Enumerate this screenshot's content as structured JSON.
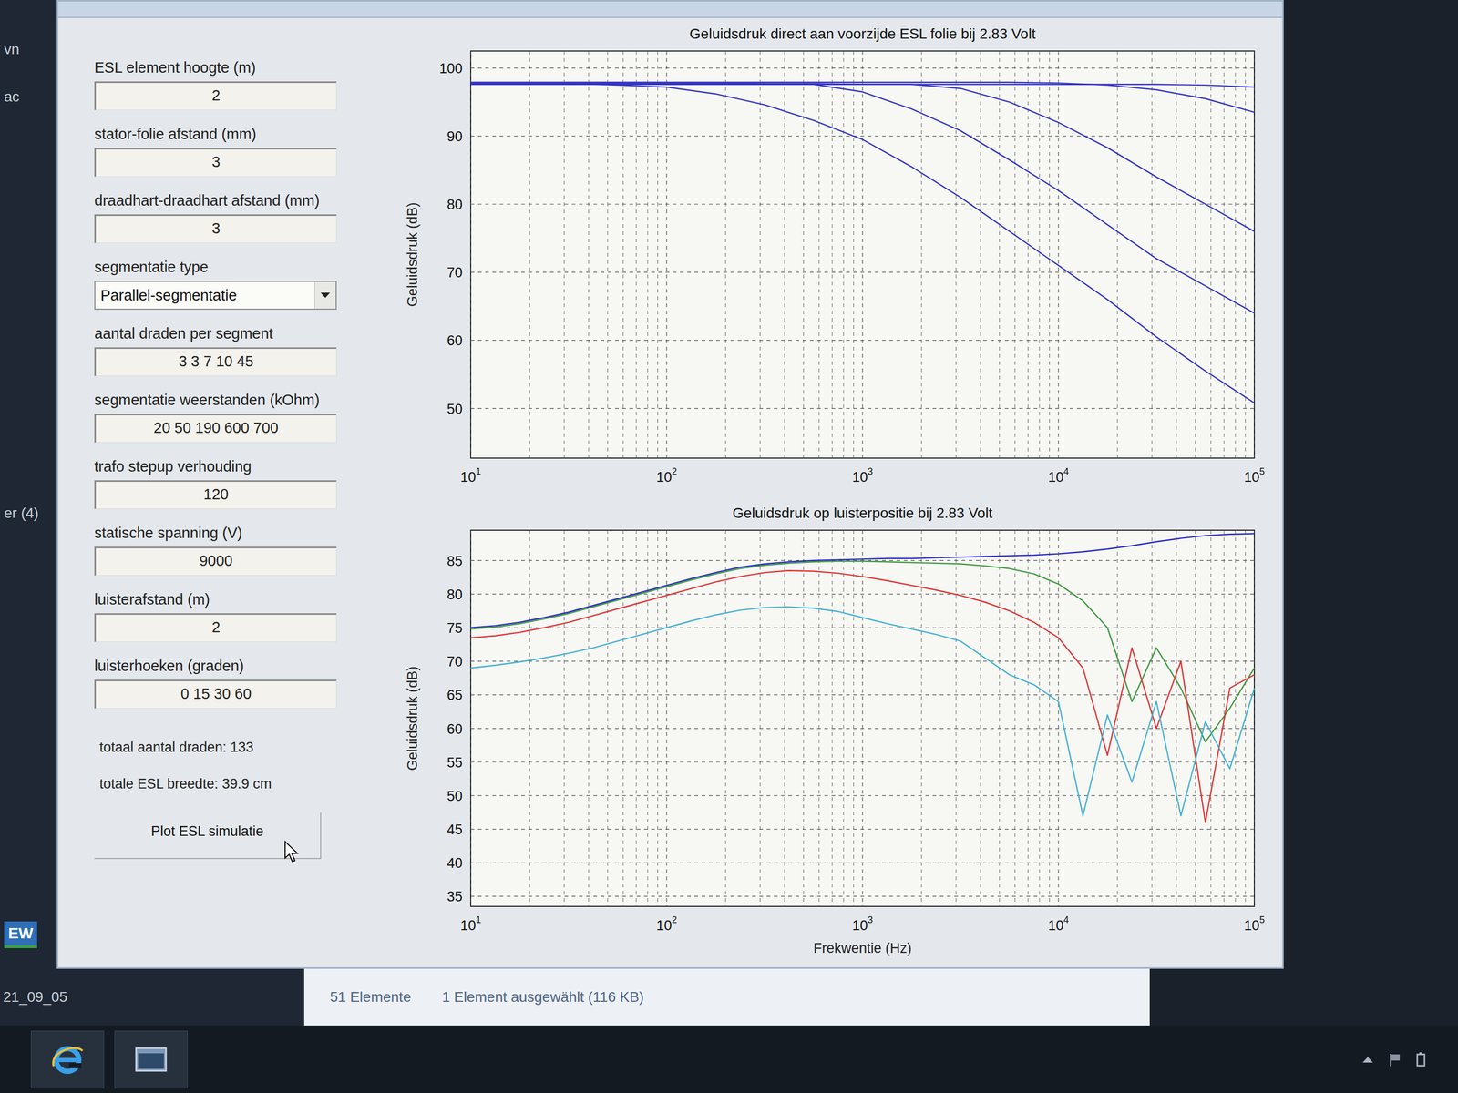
{
  "desktop_fragments": [
    "vn",
    "ac",
    "er (4)",
    "EW",
    "21_09_05"
  ],
  "form": {
    "fields": [
      {
        "label": "ESL element hoogte (m)",
        "value": "2",
        "kind": "input"
      },
      {
        "label": "stator-folie afstand (mm)",
        "value": "3",
        "kind": "input"
      },
      {
        "label": "draadhart-draadhart afstand (mm)",
        "value": "3",
        "kind": "input"
      },
      {
        "label": "segmentatie type",
        "value": "Parallel-segmentatie",
        "kind": "dropdown"
      },
      {
        "label": "aantal draden per segment",
        "value": "3 3 7 10 45",
        "kind": "input"
      },
      {
        "label": "segmentatie weerstanden (kOhm)",
        "value": "20 50 190 600 700",
        "kind": "input"
      },
      {
        "label": "trafo stepup verhouding",
        "value": "120",
        "kind": "input"
      },
      {
        "label": "statische spanning (V)",
        "value": "9000",
        "kind": "input"
      },
      {
        "label": "luisterafstand (m)",
        "value": "2",
        "kind": "input"
      },
      {
        "label": "luisterhoeken (graden)",
        "value": "0 15 30 60",
        "kind": "input"
      }
    ],
    "info": [
      "totaal aantal draden: 133",
      "totale ESL breedte: 39.9 cm"
    ],
    "button": "Plot ESL simulatie"
  },
  "charts": [
    {
      "title": "Geluidsdruk direct aan voorzijde ESL folie bij 2.83 Volt",
      "y_label": "Geluidsdruk (dB)",
      "y_ticks": [
        "100",
        "90",
        "80",
        "70",
        "60",
        "50"
      ],
      "x_ticks": [
        {
          "base": "10",
          "exp": "1"
        },
        {
          "base": "10",
          "exp": "2"
        },
        {
          "base": "10",
          "exp": "3"
        },
        {
          "base": "10",
          "exp": "4"
        },
        {
          "base": "10",
          "exp": "5"
        }
      ],
      "series": [
        {
          "values": [
            97.6,
            97.6,
            97.6,
            97.6,
            97.6,
            97.6,
            97.6,
            97.6,
            97.6,
            97.6,
            97.6,
            97.6,
            97.6,
            97.6,
            97.6,
            97.5,
            97.2
          ]
        },
        {
          "values": [
            97.9,
            97.9,
            97.9,
            97.9,
            97.9,
            97.9,
            97.9,
            97.9,
            97.9,
            97.9,
            97.9,
            97.9,
            97.8,
            97.5,
            96.8,
            95.5,
            93.5
          ]
        },
        {
          "values": [
            97.8,
            97.8,
            97.8,
            97.8,
            97.8,
            97.8,
            97.7,
            97.7,
            97.6,
            97.6,
            97,
            95,
            92,
            88.3,
            84,
            80,
            76
          ]
        },
        {
          "values": [
            97.7,
            97.7,
            97.7,
            97.7,
            97.7,
            97.7,
            97.6,
            97.6,
            96.5,
            94,
            90.8,
            86.5,
            82,
            77,
            72,
            68,
            64
          ]
        },
        {
          "values": [
            97.8,
            97.8,
            97.7,
            97.5,
            97.2,
            96.2,
            94.6,
            92.3,
            89.5,
            85.5,
            81,
            76,
            71,
            66,
            60.5,
            55.5,
            50.8
          ]
        }
      ]
    },
    {
      "title": "Geluidsdruk op luisterpositie bij 2.83 Volt",
      "y_label": "Geluidsdruk (dB)",
      "x_label": "Frekwentie (Hz)",
      "y_ticks": [
        "85",
        "80",
        "75",
        "70",
        "65",
        "60",
        "55",
        "50",
        "45",
        "40",
        "35"
      ],
      "x_ticks": [
        {
          "base": "10",
          "exp": "1"
        },
        {
          "base": "10",
          "exp": "2"
        },
        {
          "base": "10",
          "exp": "3"
        },
        {
          "base": "10",
          "exp": "4"
        },
        {
          "base": "10",
          "exp": "5"
        }
      ],
      "series": [
        {
          "color": "#2626c8",
          "values": [
            75,
            75.3,
            75.8,
            76.5,
            77.3,
            78.3,
            79.3,
            80.3,
            81.3,
            82.3,
            83.2,
            84,
            84.5,
            84.8,
            85,
            85.1,
            85.2,
            85.3,
            85.3,
            85.4,
            85.5,
            85.6,
            85.7,
            85.8,
            86,
            86.3,
            86.7,
            87.2,
            87.8,
            88.3,
            88.7,
            88.9,
            89
          ]
        },
        {
          "color": "#3c9a3c",
          "values": [
            74.8,
            75.1,
            75.6,
            76.3,
            77.1,
            78.1,
            79.1,
            80.1,
            81.1,
            82.1,
            83,
            83.8,
            84.3,
            84.6,
            84.8,
            84.9,
            84.9,
            84.8,
            84.7,
            84.6,
            84.5,
            84.2,
            83.8,
            83,
            81.5,
            79,
            75,
            64,
            72,
            66,
            58,
            63,
            69
          ]
        },
        {
          "color": "#e03232",
          "values": [
            73.5,
            73.8,
            74.3,
            75,
            75.8,
            76.8,
            77.8,
            78.8,
            79.8,
            80.8,
            81.8,
            82.6,
            83.2,
            83.5,
            83.4,
            83.1,
            82.6,
            82,
            81.3,
            80.6,
            79.8,
            78.8,
            77.5,
            75.8,
            73.5,
            69,
            56,
            72,
            60,
            70,
            46,
            66,
            68
          ]
        },
        {
          "color": "#3fb2d2",
          "values": [
            69,
            69.4,
            69.9,
            70.5,
            71.2,
            72,
            73,
            74,
            75,
            76,
            76.9,
            77.6,
            78,
            78.1,
            77.9,
            77.4,
            76.5,
            75.6,
            74.8,
            74,
            73,
            70.5,
            68,
            66.5,
            64,
            47,
            62,
            52,
            64,
            47,
            61,
            54,
            66
          ]
        }
      ]
    }
  ],
  "status_bar": [
    "51 Elemente",
    "1 Element ausgewählt (116 KB)"
  ]
}
